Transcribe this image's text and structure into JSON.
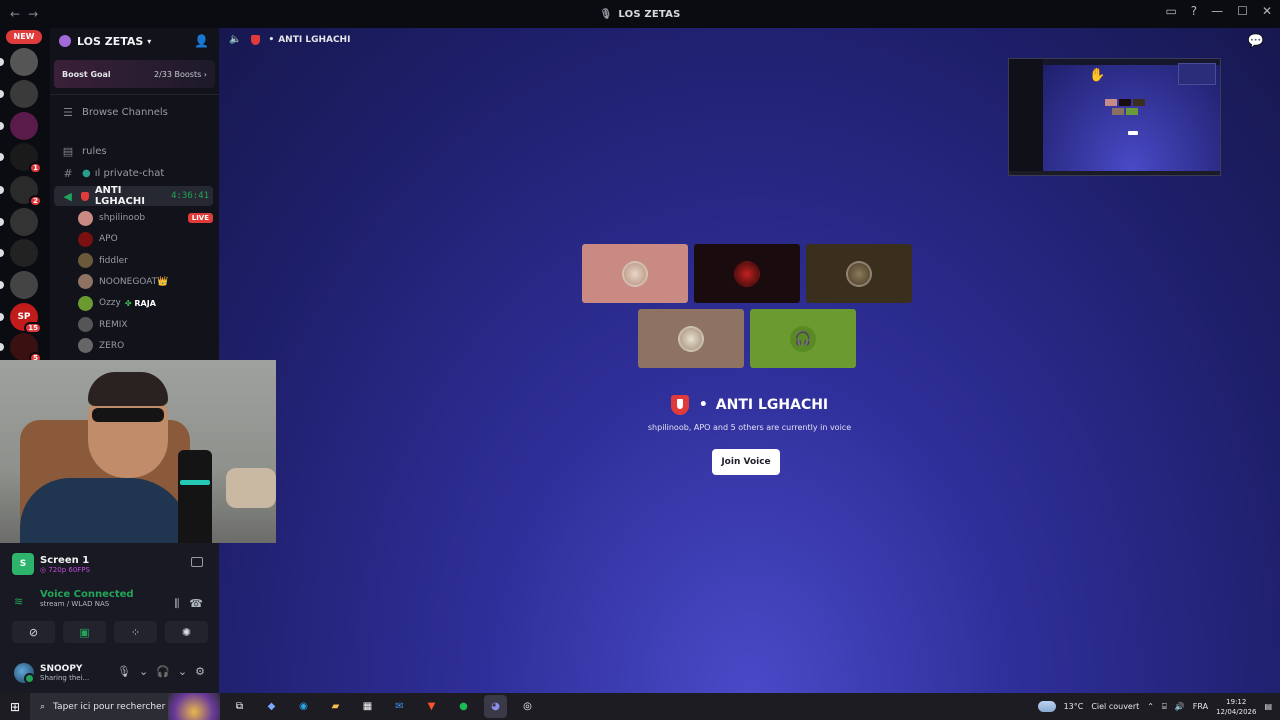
{
  "window": {
    "title": "LOS ZETAS",
    "nav": [
      "←",
      "→"
    ],
    "controls": [
      "▭",
      "?",
      "—",
      "☐",
      "✕"
    ]
  },
  "rail": {
    "new_label": "NEW",
    "servers": [
      {
        "label": "",
        "color": "#555",
        "badge": ""
      },
      {
        "label": "",
        "color": "#3a3a3a",
        "badge": ""
      },
      {
        "label": "",
        "color": "#5a1a4a",
        "badge": ""
      },
      {
        "label": "",
        "color": "#1a1a1a",
        "badge": "1"
      },
      {
        "label": "",
        "color": "#2a2a2a",
        "badge": "2"
      },
      {
        "label": "",
        "color": "#333",
        "badge": ""
      },
      {
        "label": "",
        "color": "#222",
        "badge": ""
      },
      {
        "label": "",
        "color": "#444",
        "badge": ""
      },
      {
        "label": "SP",
        "color": "#c21b1b",
        "badge": "15"
      },
      {
        "label": "",
        "color": "#3a1010",
        "badge": "5"
      }
    ]
  },
  "server": {
    "name": "LOS ZETAS",
    "boost_goal": "Boost Goal",
    "boost_progress": "2/33 Boosts",
    "browse": "Browse Channels"
  },
  "channels": {
    "rules": "rules",
    "private_chat": "ıl private-chat",
    "voice_channel": "ANTI LGHACHI",
    "timer": "4:36:41"
  },
  "voice_users": [
    {
      "name": "shpilinoob",
      "live": "LIVE"
    },
    {
      "name": "APO"
    },
    {
      "name": "fiddler"
    },
    {
      "name": "NOONEGOAT👑"
    },
    {
      "name": "Ozzy",
      "tag": "RAJA"
    },
    {
      "name": "REMIX"
    },
    {
      "name": "ZERO"
    }
  ],
  "stream": {
    "title": "Screen 1",
    "quality": "◎ 720p 60FPS"
  },
  "voice": {
    "status": "Voice Connected",
    "location": "stream / WLAD NAS"
  },
  "user": {
    "name": "SNOOPY",
    "status": "Sharing thei..."
  },
  "main": {
    "channel_name": "ANTI LGHACHI",
    "occupants": "shpilinoob, APO and 5 others are currently in voice",
    "join_label": "Join Voice"
  },
  "taskbar": {
    "search_placeholder": "Taper ici pour rechercher",
    "temperature": "13°C",
    "weather": "Ciel couvert",
    "language": "FRA",
    "time": "19:12",
    "date": "12/04/2026"
  },
  "colors": {
    "accent_green": "#23a559",
    "live_red": "#e03b3b",
    "brand_bg": "#2f2f9a"
  }
}
